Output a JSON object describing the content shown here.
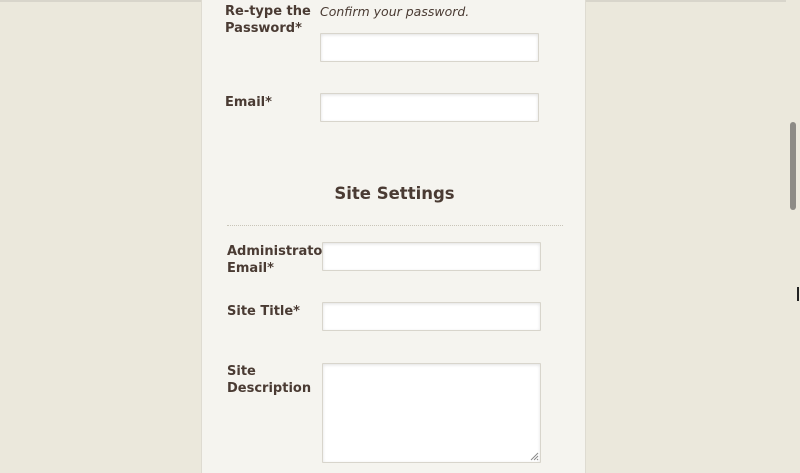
{
  "form": {
    "retype_password": {
      "label": "Re-type the Password*",
      "hint": "Confirm your password.",
      "value": ""
    },
    "email": {
      "label": "Email*",
      "value": ""
    }
  },
  "site_settings": {
    "heading": "Site Settings",
    "admin_email": {
      "label": "Administrator Email*",
      "value": ""
    },
    "site_title": {
      "label": "Site Title*",
      "value": ""
    },
    "site_description": {
      "label": "Site Description",
      "value": ""
    }
  },
  "colors": {
    "background": "#ebe8dc",
    "panel": "#f5f4ef",
    "text": "#4a3b33",
    "scrollbar_thumb": "#8d8b86"
  }
}
